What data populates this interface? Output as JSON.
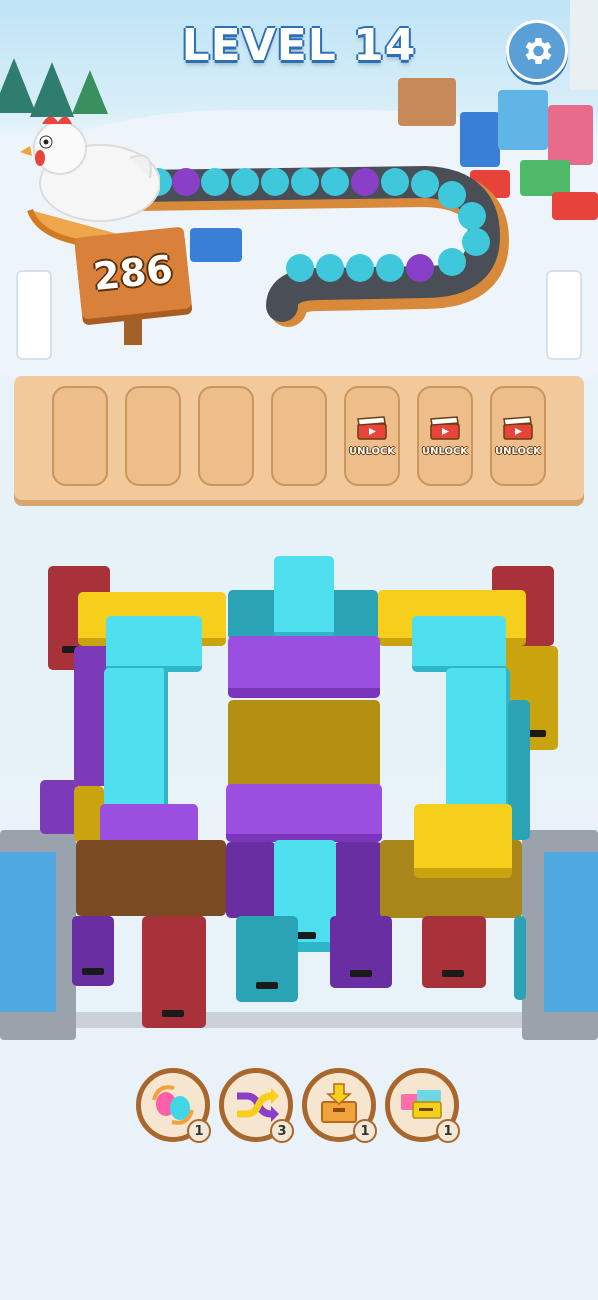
{
  "header": {
    "level_label": "LEVEL 14"
  },
  "counter": {
    "value": "286"
  },
  "slots": [
    {
      "locked": false,
      "label": ""
    },
    {
      "locked": false,
      "label": ""
    },
    {
      "locked": false,
      "label": ""
    },
    {
      "locked": false,
      "label": ""
    },
    {
      "locked": true,
      "label": "UNLOCK"
    },
    {
      "locked": true,
      "label": "UNLOCK"
    },
    {
      "locked": true,
      "label": "UNLOCK"
    }
  ],
  "powerups": [
    {
      "name": "balloons",
      "count": "1"
    },
    {
      "name": "shuffle",
      "count": "3"
    },
    {
      "name": "add-box",
      "count": "1"
    },
    {
      "name": "sort-boxes",
      "count": "1"
    }
  ],
  "colors": {
    "cyan": "#4fe0f0",
    "purple": "#9b4fe0",
    "yellow": "#f5cf1c",
    "teal": "#2aa3b5",
    "red": "#b5333c",
    "brown": "#8a5a2a"
  }
}
